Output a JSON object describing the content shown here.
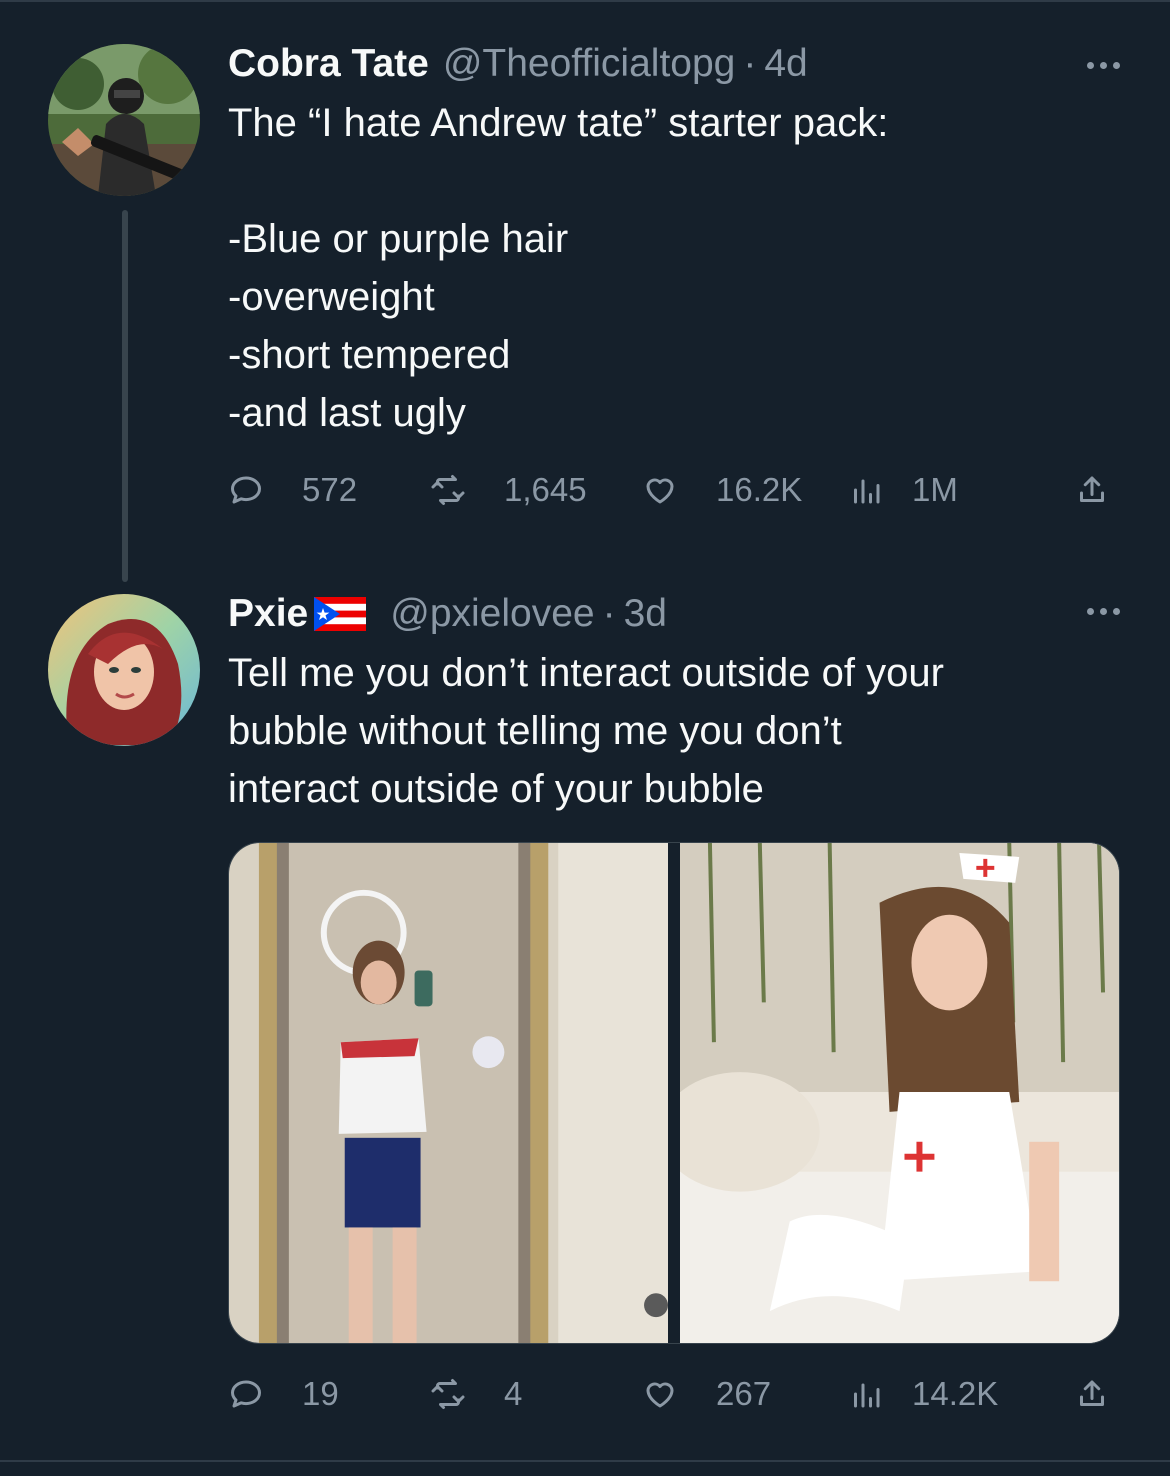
{
  "tweets": [
    {
      "name": "Cobra Tate",
      "handle": "@Theofficialtopg",
      "sep": "·",
      "time": "4d",
      "text": "The “I hate Andrew tate” starter pack:\n\n-Blue or purple hair\n-overweight\n-short tempered\n-and last ugly",
      "actions": {
        "replies": "572",
        "retweets": "1,645",
        "likes": "16.2K",
        "views": "1M"
      },
      "avatar_icon": "soldier-avatar-photo"
    },
    {
      "name": "Pxie",
      "name_flag_icon": "puerto-rico-flag-icon",
      "handle": "@pxielovee",
      "sep": "·",
      "time": "3d",
      "text": "Tell me you don’t interact outside of your\nbubble without telling me you don’t\ninteract outside of your bubble",
      "actions": {
        "replies": "19",
        "retweets": "4",
        "likes": "267",
        "views": "14.2K"
      },
      "avatar_icon": "illustrated-redhead-avatar",
      "media": [
        "mirror-selfie-photo",
        "nurse-costume-photo"
      ]
    }
  ],
  "colors": {
    "background": "#15202b",
    "text": "#f7f9f9",
    "muted": "#8b98a5",
    "divider": "#38444d"
  }
}
